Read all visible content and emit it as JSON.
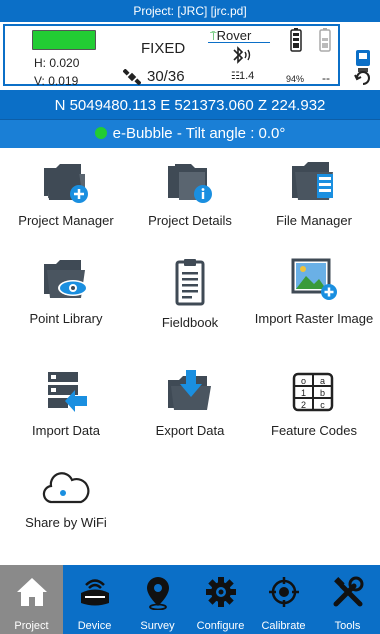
{
  "header": {
    "project_title": "Project: [JRC] [jrc.pd]"
  },
  "status": {
    "h_value": "H: 0.020",
    "v_value": "V: 0.019",
    "fix_status": "FIXED",
    "satellites": "30/36",
    "rover_label": "Rover",
    "pdop": "1.4",
    "battery_percent": "94%",
    "second_battery": "--",
    "fix_color": "#22cc33"
  },
  "coordinates": "N 5049480.113  E 521373.060  Z 224.932",
  "bubble": {
    "text": "e-Bubble - Tilt angle : 0.0°"
  },
  "menu": [
    {
      "label": "Project Manager",
      "icon": "folder-plus-icon"
    },
    {
      "label": "Project Details",
      "icon": "folder-info-icon"
    },
    {
      "label": "File Manager",
      "icon": "folder-list-icon"
    },
    {
      "label": "Point Library",
      "icon": "folder-eye-icon"
    },
    {
      "label": "Fieldbook",
      "icon": "clipboard-icon"
    },
    {
      "label": "Import Raster Image",
      "icon": "image-plus-icon"
    },
    {
      "label": "Import Data",
      "icon": "import-icon"
    },
    {
      "label": "Export Data",
      "icon": "export-icon"
    },
    {
      "label": "Feature Codes",
      "icon": "feature-codes-icon"
    },
    {
      "label": "Share by WiFi",
      "icon": "cloud-icon"
    }
  ],
  "nav": [
    {
      "label": "Project",
      "icon": "home-icon",
      "active": true
    },
    {
      "label": "Device",
      "icon": "receiver-icon"
    },
    {
      "label": "Survey",
      "icon": "location-pin-icon"
    },
    {
      "label": "Configure",
      "icon": "gear-icon"
    },
    {
      "label": "Calibrate",
      "icon": "crosshair-icon"
    },
    {
      "label": "Tools",
      "icon": "tools-icon"
    }
  ],
  "colors": {
    "primary": "#0b6fc7",
    "active_tab": "#8a8a8a",
    "icon_dark": "#3f4a55",
    "accent": "#1a8fe0"
  }
}
